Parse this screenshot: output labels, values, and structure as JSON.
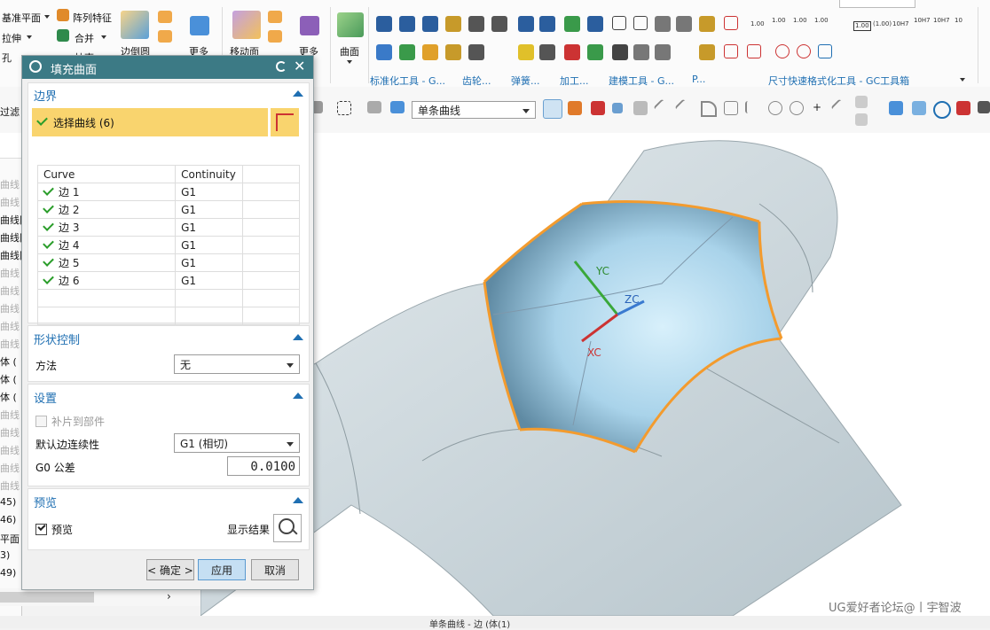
{
  "ribbon": {
    "left_items": [
      "基准平面",
      "阵列特征",
      "拉伸",
      "合并",
      "孔",
      "抽壳"
    ],
    "edge_blend": "边倒圆",
    "more1": "更多",
    "move_face": "移动面",
    "more2": "更多",
    "surface": "曲面",
    "groups": [
      "标准化工具 - G...",
      "齿轮...",
      "弹簧...",
      "加工...",
      "建模工具 - G...",
      "P...",
      "尺寸快速格式化工具 - GC工具箱"
    ],
    "dim_labels": [
      "1.00",
      "1.00",
      "1.00",
      "1.00",
      "1.00",
      "(1.00)",
      "10H7",
      "10H7",
      "10H7",
      "10"
    ]
  },
  "selection_bar": {
    "filter_label": "过滤",
    "curve_rule": "单条曲线"
  },
  "navigator": {
    "rows": [
      "曲线",
      "曲线",
      "曲线网",
      "曲线网",
      "曲线网",
      "曲线",
      "曲线",
      "曲线",
      "曲线",
      "曲线",
      "体 (",
      "体 (",
      "体 (",
      "曲线",
      "曲线",
      "曲线",
      "曲线",
      "曲线",
      "45)",
      "46)",
      "平面",
      "3)",
      "49)"
    ]
  },
  "dialog": {
    "title": "填充曲面",
    "boundary": {
      "header": "边界",
      "select_label": "选择曲线 (6)",
      "columns": [
        "Curve",
        "Continuity"
      ],
      "rows": [
        {
          "curve": "边 1",
          "continuity": "G1"
        },
        {
          "curve": "边 2",
          "continuity": "G1"
        },
        {
          "curve": "边 3",
          "continuity": "G1"
        },
        {
          "curve": "边 4",
          "continuity": "G1"
        },
        {
          "curve": "边 5",
          "continuity": "G1"
        },
        {
          "curve": "边 6",
          "continuity": "G1"
        }
      ]
    },
    "shape_control": {
      "header": "形状控制",
      "method_label": "方法",
      "method_value": "无"
    },
    "settings": {
      "header": "设置",
      "patch_to_part": "补片到部件",
      "default_continuity_label": "默认边连续性",
      "default_continuity_value": "G1 (相切)",
      "g0_tol_label": "G0 公差",
      "g0_tol_value": "0.0100"
    },
    "preview": {
      "header": "预览",
      "preview_label": "预览",
      "show_result": "显示结果"
    },
    "buttons": {
      "ok": "< 确定 >",
      "apply": "应用",
      "cancel": "取消"
    }
  },
  "viewport": {
    "axes": {
      "yc": "YC",
      "zc": "ZC",
      "xc": "XC"
    },
    "watermark": "UG爱好者论坛@丨宇智波"
  },
  "status": {
    "text": "单条曲线 - 边 (体(1)"
  },
  "colors": {
    "title_bar": "#3c7a85",
    "accent": "#1f6fb2",
    "selected_row": "#f9d46e",
    "apply_btn": "#c5dff3",
    "fill_surface": "#a9d3ea",
    "edge_highlight": "#f39b2e",
    "body": "#c9d5db"
  }
}
